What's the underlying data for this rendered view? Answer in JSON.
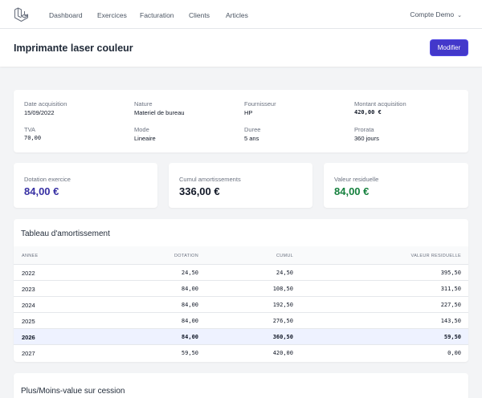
{
  "nav": {
    "links": [
      "Dashboard",
      "Exercices",
      "Facturation",
      "Clients",
      "Articles"
    ],
    "account": "Compte Demo"
  },
  "header": {
    "title": "Imprimante laser couleur",
    "edit_label": "Modifier"
  },
  "details": [
    {
      "label": "Date acquisition",
      "value": "15/09/2022"
    },
    {
      "label": "Nature",
      "value": "Materiel de bureau"
    },
    {
      "label": "Fournisseur",
      "value": "HP"
    },
    {
      "label": "Montant acquisition",
      "value": "420,00 €"
    },
    {
      "label": "TVA",
      "value": "70,00"
    },
    {
      "label": "Mode",
      "value": "Lineaire"
    },
    {
      "label": "Duree",
      "value": "5 ans"
    },
    {
      "label": "Prorata",
      "value": "360 jours"
    }
  ],
  "stats": [
    {
      "label": "Dotation exercice",
      "value": "84,00 €",
      "color": "#3730a3"
    },
    {
      "label": "Cumul amortissements",
      "value": "336,00 €",
      "color": "#111827"
    },
    {
      "label": "Valeur residuelle",
      "value": "84,00 €",
      "color": "#15803d"
    }
  ],
  "table": {
    "title": "Tableau d'amortissement",
    "columns": [
      "ANNEE",
      "DOTATION",
      "CUMUL",
      "VALEUR RESIDUELLE"
    ],
    "rows": [
      {
        "year": "2022",
        "dotation": "24,50",
        "cumul": "24,50",
        "residuelle": "395,50"
      },
      {
        "year": "2023",
        "dotation": "84,00",
        "cumul": "108,50",
        "residuelle": "311,50"
      },
      {
        "year": "2024",
        "dotation": "84,00",
        "cumul": "192,50",
        "residuelle": "227,50"
      },
      {
        "year": "2025",
        "dotation": "84,00",
        "cumul": "276,50",
        "residuelle": "143,50"
      },
      {
        "year": "2026",
        "dotation": "84,00",
        "cumul": "360,50",
        "residuelle": "59,50"
      },
      {
        "year": "2027",
        "dotation": "59,50",
        "cumul": "420,00",
        "residuelle": "0,00"
      }
    ],
    "highlight_year": "2026"
  },
  "cession": {
    "title": "Plus/Moins-value sur cession"
  }
}
